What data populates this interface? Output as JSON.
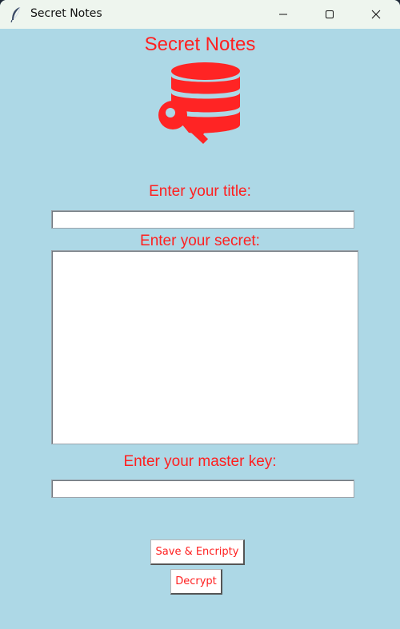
{
  "window": {
    "title": "Secret Notes",
    "icon": "feather-icon",
    "controls": [
      "minimize-icon",
      "maximize-icon",
      "close-icon"
    ]
  },
  "app": {
    "heading": "Secret Notes",
    "logo_icon": "database-key-icon",
    "title_label": "Enter your title:",
    "title_value": "",
    "secret_label": "Enter your secret:",
    "secret_value": "",
    "master_key_label": "Enter your master key:",
    "master_key_value": "",
    "save_button": "Save & Encripty",
    "decrypt_button": "Decrypt"
  },
  "colors": {
    "background": "#add8e6",
    "accent": "#ff2020",
    "titlebar": "#eef5ee"
  }
}
